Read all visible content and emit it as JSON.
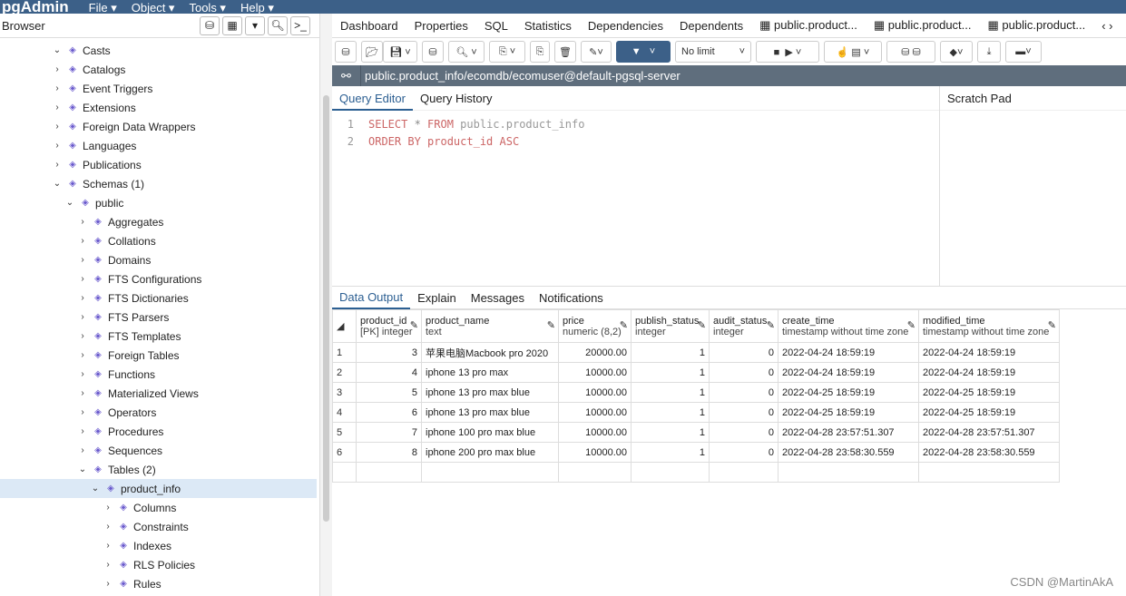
{
  "app": {
    "logo": "pgAdmin",
    "menus": [
      "File ▾",
      "Object ▾",
      "Tools ▾",
      "Help ▾"
    ]
  },
  "browser": {
    "title": "Browser",
    "tools": [
      "db-icon",
      "table-icon",
      "filter-table-icon",
      "search-icon",
      "terminal-icon"
    ],
    "tree": [
      {
        "label": "Casts",
        "level": 0,
        "exp": "v",
        "icon": "casts-icon"
      },
      {
        "label": "Catalogs",
        "level": 0,
        "exp": ">",
        "icon": "catalogs-icon"
      },
      {
        "label": "Event Triggers",
        "level": 0,
        "exp": ">",
        "icon": "event-triggers-icon"
      },
      {
        "label": "Extensions",
        "level": 0,
        "exp": ">",
        "icon": "extensions-icon"
      },
      {
        "label": "Foreign Data Wrappers",
        "level": 0,
        "exp": ">",
        "icon": "fdw-icon"
      },
      {
        "label": "Languages",
        "level": 0,
        "exp": ">",
        "icon": "languages-icon"
      },
      {
        "label": "Publications",
        "level": 0,
        "exp": ">",
        "icon": "publications-icon"
      },
      {
        "label": "Schemas (1)",
        "level": 0,
        "exp": "v",
        "icon": "schemas-icon"
      },
      {
        "label": "public",
        "level": 1,
        "exp": "v",
        "icon": "schema-icon"
      },
      {
        "label": "Aggregates",
        "level": 2,
        "exp": ">",
        "icon": "aggregates-icon"
      },
      {
        "label": "Collations",
        "level": 2,
        "exp": ">",
        "icon": "collations-icon"
      },
      {
        "label": "Domains",
        "level": 2,
        "exp": ">",
        "icon": "domains-icon"
      },
      {
        "label": "FTS Configurations",
        "level": 2,
        "exp": ">",
        "icon": "fts-config-icon"
      },
      {
        "label": "FTS Dictionaries",
        "level": 2,
        "exp": ">",
        "icon": "fts-dict-icon"
      },
      {
        "label": "FTS Parsers",
        "level": 2,
        "exp": ">",
        "icon": "fts-parser-icon"
      },
      {
        "label": "FTS Templates",
        "level": 2,
        "exp": ">",
        "icon": "fts-template-icon"
      },
      {
        "label": "Foreign Tables",
        "level": 2,
        "exp": ">",
        "icon": "foreign-tables-icon"
      },
      {
        "label": "Functions",
        "level": 2,
        "exp": ">",
        "icon": "functions-icon"
      },
      {
        "label": "Materialized Views",
        "level": 2,
        "exp": ">",
        "icon": "mviews-icon"
      },
      {
        "label": "Operators",
        "level": 2,
        "exp": ">",
        "icon": "operators-icon"
      },
      {
        "label": "Procedures",
        "level": 2,
        "exp": ">",
        "icon": "procedures-icon"
      },
      {
        "label": "Sequences",
        "level": 2,
        "exp": ">",
        "icon": "sequences-icon"
      },
      {
        "label": "Tables (2)",
        "level": 2,
        "exp": "v",
        "icon": "tables-icon"
      },
      {
        "label": "product_info",
        "level": 3,
        "exp": "v",
        "icon": "table-icon",
        "selected": true
      },
      {
        "label": "Columns",
        "level": 4,
        "exp": ">",
        "icon": "columns-icon"
      },
      {
        "label": "Constraints",
        "level": 4,
        "exp": ">",
        "icon": "constraints-icon"
      },
      {
        "label": "Indexes",
        "level": 4,
        "exp": ">",
        "icon": "indexes-icon"
      },
      {
        "label": "RLS Policies",
        "level": 4,
        "exp": ">",
        "icon": "rls-icon"
      },
      {
        "label": "Rules",
        "level": 4,
        "exp": ">",
        "icon": "rules-icon"
      }
    ]
  },
  "tabs": [
    "Dashboard",
    "Properties",
    "SQL",
    "Statistics",
    "Dependencies",
    "Dependents",
    "public.product...",
    "public.product...",
    "public.product..."
  ],
  "toolbar": {
    "limit": "No limit"
  },
  "connection": "public.product_info/ecomdb/ecomuser@default-pgsql-server",
  "query_tabs": [
    "Query Editor",
    "Query History"
  ],
  "scratch_pad": "Scratch Pad",
  "sql": {
    "line1": {
      "n": "1",
      "kw1": "SELECT",
      "mid": " * ",
      "kw2": "FROM",
      "rest": " public.product_info"
    },
    "line2": {
      "n": "2",
      "text": "ORDER BY product_id ASC"
    }
  },
  "output_tabs": [
    "Data Output",
    "Explain",
    "Messages",
    "Notifications"
  ],
  "columns": [
    {
      "name": "product_id",
      "type": "[PK] integer"
    },
    {
      "name": "product_name",
      "type": "text"
    },
    {
      "name": "price",
      "type": "numeric (8,2)"
    },
    {
      "name": "publish_status",
      "type": "integer"
    },
    {
      "name": "audit_status",
      "type": "integer"
    },
    {
      "name": "create_time",
      "type": "timestamp without time zone"
    },
    {
      "name": "modified_time",
      "type": "timestamp without time zone"
    }
  ],
  "rows": [
    [
      "1",
      "3",
      "苹果电脑Macbook pro 2020",
      "20000.00",
      "1",
      "0",
      "2022-04-24 18:59:19",
      "2022-04-24 18:59:19"
    ],
    [
      "2",
      "4",
      "iphone 13 pro max",
      "10000.00",
      "1",
      "0",
      "2022-04-24 18:59:19",
      "2022-04-24 18:59:19"
    ],
    [
      "3",
      "5",
      "iphone 13 pro max blue",
      "10000.00",
      "1",
      "0",
      "2022-04-25 18:59:19",
      "2022-04-25 18:59:19"
    ],
    [
      "4",
      "6",
      "iphone 13 pro max blue",
      "10000.00",
      "1",
      "0",
      "2022-04-25 18:59:19",
      "2022-04-25 18:59:19"
    ],
    [
      "5",
      "7",
      "iphone 100 pro max blue",
      "10000.00",
      "1",
      "0",
      "2022-04-28 23:57:51.307",
      "2022-04-28 23:57:51.307"
    ],
    [
      "6",
      "8",
      "iphone 200 pro max blue",
      "10000.00",
      "1",
      "0",
      "2022-04-28 23:58:30.559",
      "2022-04-28 23:58:30.559"
    ]
  ],
  "watermark": "CSDN @MartinAkA",
  "colors": {
    "topbar": "#3c6088",
    "accent": "#2c5f92",
    "selected": "#dce9f6"
  }
}
